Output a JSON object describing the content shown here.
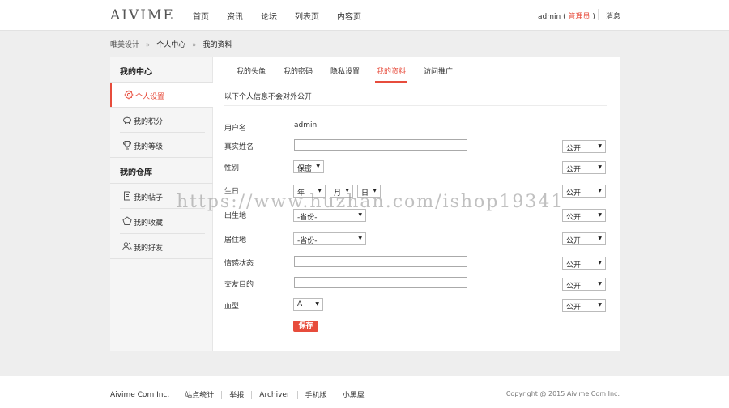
{
  "header": {
    "logo": "AIVIME",
    "nav": [
      "首页",
      "资讯",
      "论坛",
      "列表页",
      "内容页"
    ],
    "user": "admin",
    "user_role_open": "(",
    "user_role": "管理员",
    "user_role_close": ")",
    "messages": "消息"
  },
  "breadcrumb": [
    "唯美设计",
    "个人中心",
    "我的资料"
  ],
  "breadcrumb_sep": "»",
  "sidebar": {
    "section1_title": "我的中心",
    "section1_items": [
      {
        "label": "个人设置",
        "icon": "gear-icon"
      },
      {
        "label": "我的积分",
        "icon": "piggy-bank-icon"
      },
      {
        "label": "我的等级",
        "icon": "trophy-icon"
      }
    ],
    "section2_title": "我的仓库",
    "section2_items": [
      {
        "label": "我的帖子",
        "icon": "document-icon"
      },
      {
        "label": "我的收藏",
        "icon": "pentagon-icon"
      },
      {
        "label": "我的好友",
        "icon": "users-icon"
      }
    ]
  },
  "tabs": [
    "我的头像",
    "我的密码",
    "隐私设置",
    "我的资料",
    "访问推广"
  ],
  "active_tab": 3,
  "notice": "以下个人信息不会对外公开",
  "form": {
    "username_label": "用户名",
    "username_value": "admin",
    "realname_label": "真实姓名",
    "gender_label": "性别",
    "gender_value": "保密",
    "birthday_label": "生日",
    "birth_year": "年",
    "birth_month": "月",
    "birth_day": "日",
    "birthplace_label": "出生地",
    "birthplace_value": "-省份-",
    "residence_label": "居住地",
    "residence_value": "-省份-",
    "emotion_label": "情感状态",
    "purpose_label": "交友目的",
    "blood_label": "血型",
    "blood_value": "A",
    "privacy_value": "公开",
    "save_label": "保存"
  },
  "watermark": "https://www.huzhan.com/ishop19341",
  "footer": {
    "links": [
      "Aivime Com Inc.",
      "站点统计",
      "举报",
      "Archiver",
      "手机版",
      "小黑屋"
    ],
    "copyright": "Copyright @ 2015 Aivime Com Inc."
  },
  "colors": {
    "accent": "#e74c3c",
    "background": "#eeeeee"
  }
}
